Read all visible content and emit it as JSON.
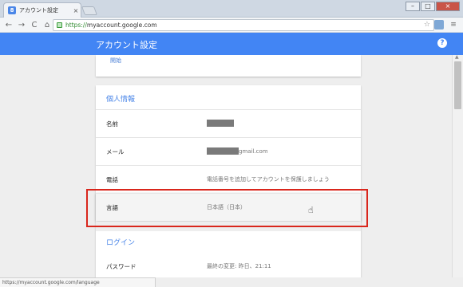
{
  "browser": {
    "tab_title": "アカウント設定",
    "tab_favicon": "8",
    "tab_close": "×",
    "url_scheme": "https://",
    "url_host": "myaccount.google.com",
    "win_min": "–",
    "win_max": "□",
    "win_close": "×",
    "nav_back": "←",
    "nav_forward": "→",
    "nav_reload": "C",
    "nav_home": "⌂",
    "star": "☆",
    "menu": "≡"
  },
  "header": {
    "title": "アカウント設定",
    "help": "?"
  },
  "top_card": {
    "link": "開始"
  },
  "personal": {
    "section_title": "個人情報",
    "rows": [
      {
        "label": "名前",
        "value": ""
      },
      {
        "label": "メール",
        "value": "gmail.com"
      },
      {
        "label": "電話",
        "value": "電話番号を追加してアカウントを保護しましょう"
      },
      {
        "label": "言語",
        "value": "日本語（日本）"
      }
    ]
  },
  "login": {
    "section_title": "ログイン",
    "rows": [
      {
        "label": "パスワード",
        "value": "最終の変更: 昨日、21:11"
      }
    ]
  },
  "statusbar": {
    "url": "https://myaccount.google.com/language"
  },
  "colors": {
    "header_bg": "#4285f4",
    "accent": "#4a86e8",
    "highlight": "#d9261c"
  }
}
